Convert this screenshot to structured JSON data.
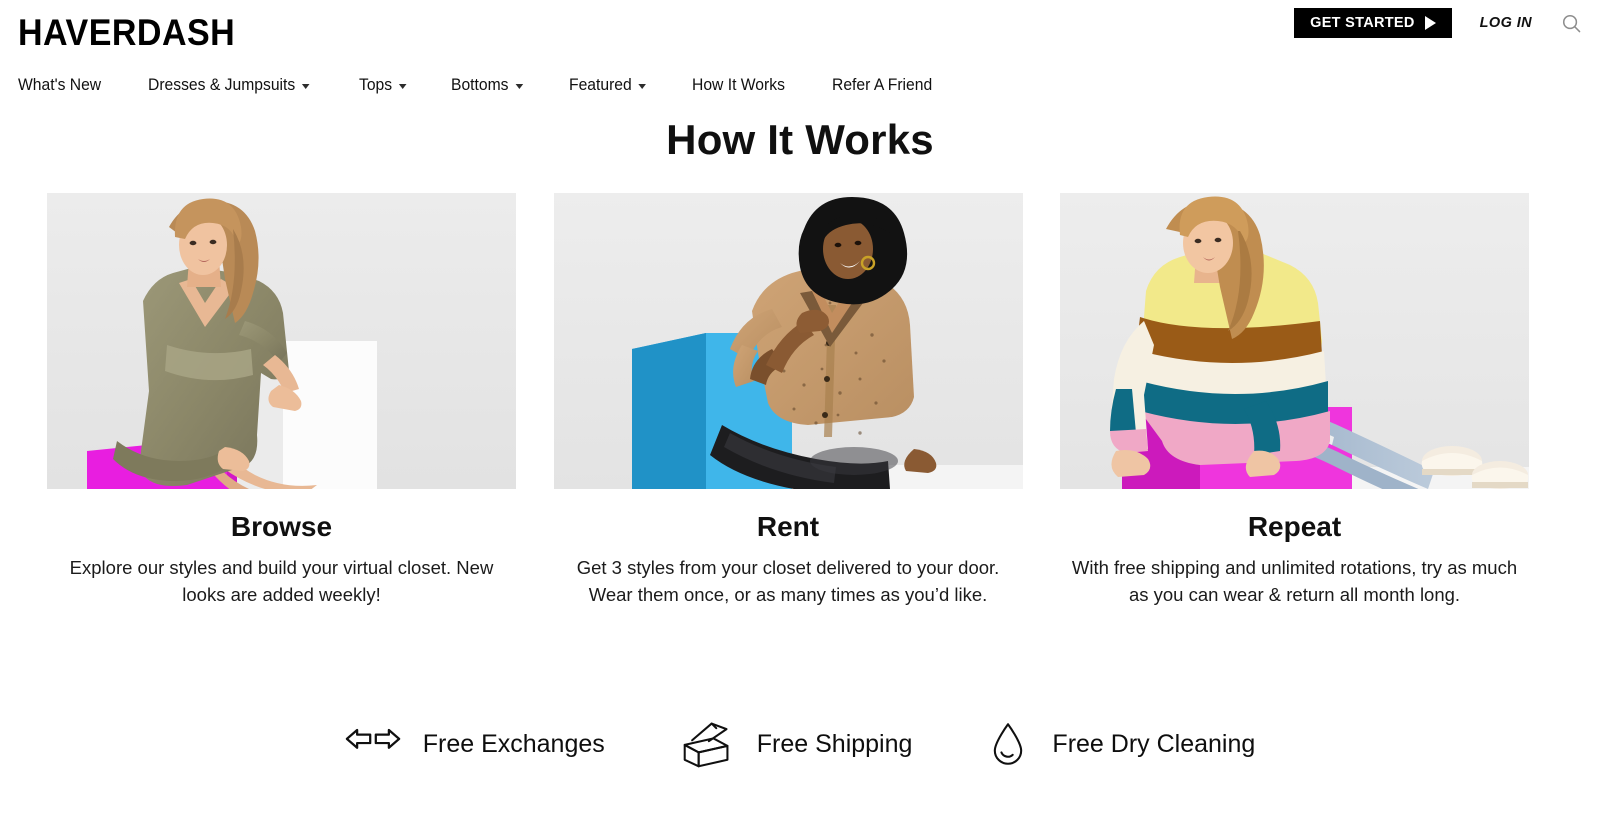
{
  "header": {
    "brand": "HAVERDASH",
    "get_started_label": "GET STARTED",
    "login_label": "LOG IN",
    "search_icon": "search-icon",
    "play_icon": "play-triangle-icon",
    "accent_color": "#000000",
    "search_icon_color": "#8d8d8d"
  },
  "nav": {
    "items": [
      {
        "label": "What's New",
        "has_dropdown": false
      },
      {
        "label": "Dresses & Jumpsuits",
        "has_dropdown": true
      },
      {
        "label": "Tops",
        "has_dropdown": true
      },
      {
        "label": "Bottoms",
        "has_dropdown": true
      },
      {
        "label": "Featured",
        "has_dropdown": true
      },
      {
        "label": "How It Works",
        "has_dropdown": false
      },
      {
        "label": "Refer A Friend",
        "has_dropdown": false
      }
    ]
  },
  "main": {
    "title": "How It Works",
    "cards": [
      {
        "title": "Browse",
        "description": "Explore our styles and build your virtual closet. New looks are added weekly!",
        "photo_alt": "Model in olive green patterned wrap dress seated on a magenta cube beside a white cube",
        "photo_colors": {
          "background": "#e8e8e8",
          "cube_accent": "#e81ee0",
          "garment": "#8e8a6a",
          "secondary_cube": "#f7f7f7"
        }
      },
      {
        "title": "Rent",
        "description": "Get 3 styles from your closet delivered to your door. Wear them once, or as many times as you’d like.",
        "photo_alt": "Model in tan speckled blouse and black leather leggings seated on a blue cube",
        "photo_colors": {
          "background": "#e8e8e8",
          "cube_accent": "#2eaae2",
          "garment": "#c49a6c",
          "secondary_cube": "#f2f2f2"
        }
      },
      {
        "title": "Repeat",
        "description": "With free shipping and unlimited rotations, try as much as you can wear & return all month long.",
        "photo_alt": "Model in colorblock striped sweater and light jeans reclining on a magenta cube",
        "photo_colors": {
          "background": "#e8e8e8",
          "cube_accent": "#e422d2",
          "garment": "#f2e98a",
          "secondary_cube": "#f2f2f2"
        }
      }
    ]
  },
  "perks": [
    {
      "label": "Free Exchanges",
      "icon": "exchange-arrows-icon"
    },
    {
      "label": "Free Shipping",
      "icon": "open-box-icon"
    },
    {
      "label": "Free Dry Cleaning",
      "icon": "water-droplet-icon"
    }
  ]
}
